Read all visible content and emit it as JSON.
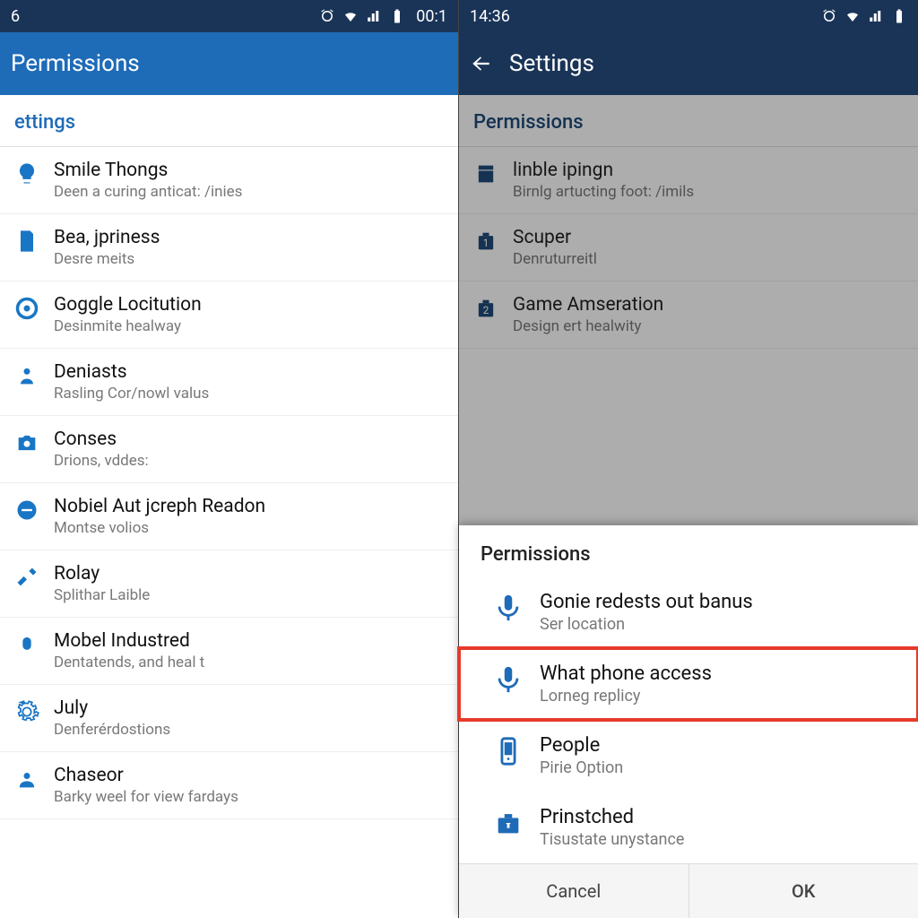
{
  "left": {
    "statusbar": {
      "left_time": "6",
      "right_time": "00:1"
    },
    "appbar": {
      "title": "Permissions"
    },
    "section": "ettings",
    "items": [
      {
        "title": "Smile Thongs",
        "sub": "Deen a curing anticat: /inies"
      },
      {
        "title": "Bea, jpriness",
        "sub": "Desre meits"
      },
      {
        "title": "Goggle Locitution",
        "sub": "Desinmite healway"
      },
      {
        "title": "Deniasts",
        "sub": "Rasling Cor/nowl valus"
      },
      {
        "title": "Conses",
        "sub": "Drions, vddes:"
      },
      {
        "title": "Nobiel Aut jcreph Readon",
        "sub": "Montse volios"
      },
      {
        "title": "Rolay",
        "sub": "Splithar Laible"
      },
      {
        "title": "Mobel Industred",
        "sub": "Dentatends, and heal t"
      },
      {
        "title": "July",
        "sub": "Denferérdostions"
      },
      {
        "title": "Chaseor",
        "sub": "Barky weel for view fardays"
      }
    ]
  },
  "right": {
    "statusbar": {
      "left_time": "14:36"
    },
    "appbar": {
      "title": "Settings"
    },
    "section": "Permissions",
    "bg_items": [
      {
        "title": "linble ipingn",
        "sub": "Birnlg artucting foot: /imils"
      },
      {
        "title": "Scuper",
        "sub": "Denruturreitl"
      },
      {
        "title": "Game Amseration",
        "sub": "Design ert healwity"
      }
    ],
    "sheet": {
      "header": "Permissions",
      "items": [
        {
          "title": "Gonie redests out banus",
          "sub": "Ser location"
        },
        {
          "title": "What phone access",
          "sub": "Lorneg replicy"
        },
        {
          "title": "People",
          "sub": "Pirie Option"
        },
        {
          "title": "Prinstched",
          "sub": "Tisustate unystance"
        }
      ],
      "cancel": "Cancel",
      "ok": "OK"
    }
  }
}
